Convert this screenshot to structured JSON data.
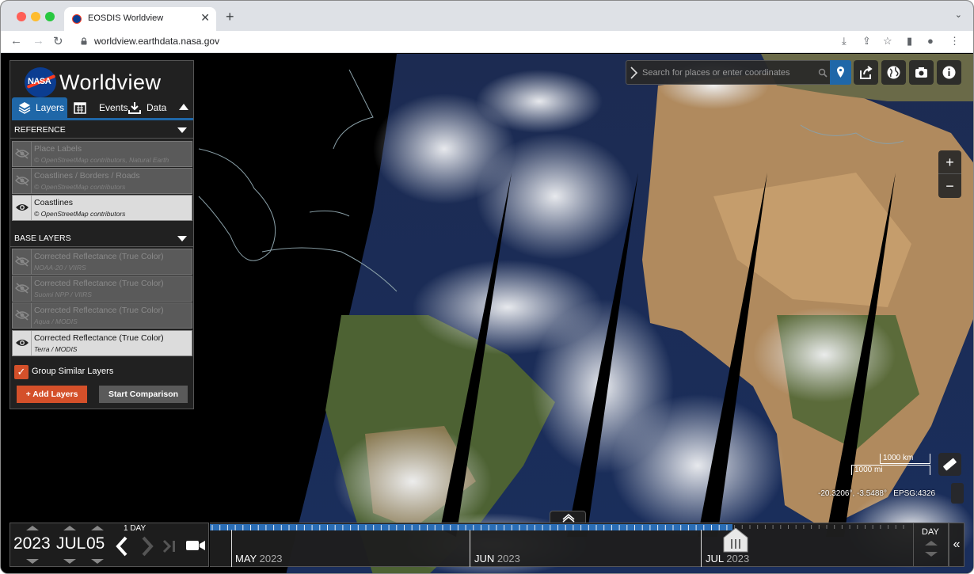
{
  "browser": {
    "tab_title": "EOSDIS Worldview",
    "tab_close": "✕",
    "new_tab": "+",
    "url": "worldview.earthdata.nasa.gov"
  },
  "app": {
    "logo_text": "NASA",
    "title": "Worldview"
  },
  "sidebar": {
    "tabs": [
      {
        "label": "Layers",
        "icon": "layers-icon",
        "active": true
      },
      {
        "label": "Events",
        "icon": "calendar-icon",
        "active": false
      },
      {
        "label": "Data",
        "icon": "download-icon",
        "active": false
      }
    ],
    "reference": {
      "heading": "REFERENCE",
      "layers": [
        {
          "title": "Place Labels",
          "subtitle": "© OpenStreetMap contributors, Natural Earth",
          "visible": false
        },
        {
          "title": "Coastlines / Borders / Roads",
          "subtitle": "© OpenStreetMap contributors",
          "visible": false
        },
        {
          "title": "Coastlines",
          "subtitle": "© OpenStreetMap contributors",
          "visible": true
        }
      ]
    },
    "base": {
      "heading": "BASE LAYERS",
      "layers": [
        {
          "title": "Corrected Reflectance (True Color)",
          "subtitle": "NOAA-20 / VIIRS",
          "visible": false
        },
        {
          "title": "Corrected Reflectance (True Color)",
          "subtitle": "Suomi NPP / VIIRS",
          "visible": false
        },
        {
          "title": "Corrected Reflectance (True Color)",
          "subtitle": "Aqua / MODIS",
          "visible": false
        },
        {
          "title": "Corrected Reflectance (True Color)",
          "subtitle": "Terra / MODIS",
          "visible": true
        }
      ]
    },
    "group_similar": {
      "label": "Group Similar Layers",
      "checked": true,
      "mark": "✓"
    },
    "add_layers_label": "+ Add Layers",
    "start_comparison_label": "Start Comparison"
  },
  "map": {
    "search_placeholder": "Search for places or enter coordinates",
    "zoom_in": "+",
    "zoom_out": "−",
    "scale_km": "1000 km",
    "scale_mi": "1000 mi",
    "coordinates": "-20.3206°, -3.5488°",
    "projection": "EPSG:4326",
    "colors": {
      "accent": "#1f67a8",
      "orange": "#d4502a"
    }
  },
  "timeline": {
    "year": "2023",
    "month": "JUL",
    "day": "05",
    "step": "1 DAY",
    "months": [
      {
        "name": "MAY",
        "year": "2023"
      },
      {
        "name": "JUN",
        "year": "2023"
      },
      {
        "name": "JUL",
        "year": "2023"
      }
    ],
    "zoom_level": "DAY",
    "collapse": "«"
  }
}
